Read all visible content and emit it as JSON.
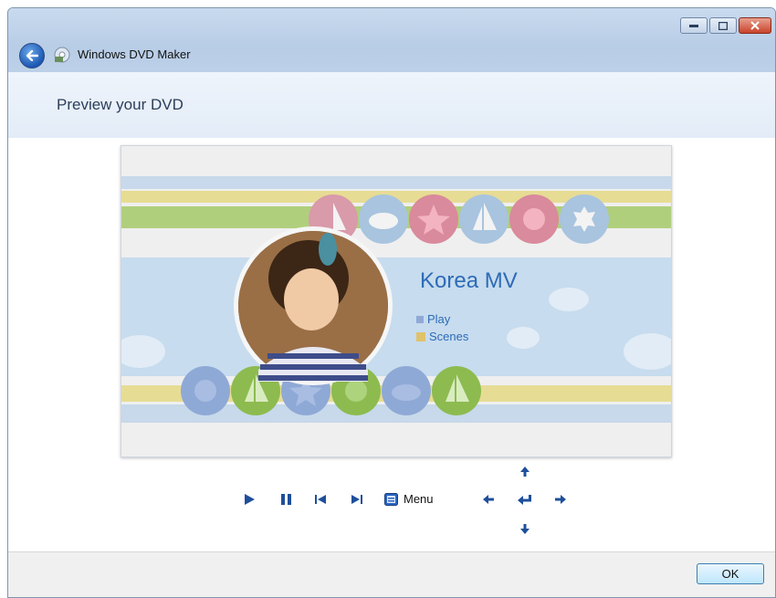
{
  "window": {
    "title": "Windows DVD Maker"
  },
  "header": {
    "page_title": "Preview your DVD"
  },
  "preview": {
    "dvd_title": "Korea MV",
    "menu_items": [
      {
        "label": "Play",
        "color": "#8fa9d6"
      },
      {
        "label": "Scenes",
        "color": "#e0c26a"
      }
    ]
  },
  "controls": {
    "menu_label": "Menu",
    "icons": [
      "play-icon",
      "pause-icon",
      "previous-chapter-icon",
      "next-chapter-icon",
      "menu-icon",
      "arrow-left-icon",
      "arrow-up-icon",
      "enter-icon",
      "arrow-down-icon",
      "arrow-right-icon"
    ]
  },
  "footer": {
    "ok_label": "OK"
  },
  "colors": {
    "accent": "#1f4f9b",
    "title_blue": "#2e6bb7"
  }
}
